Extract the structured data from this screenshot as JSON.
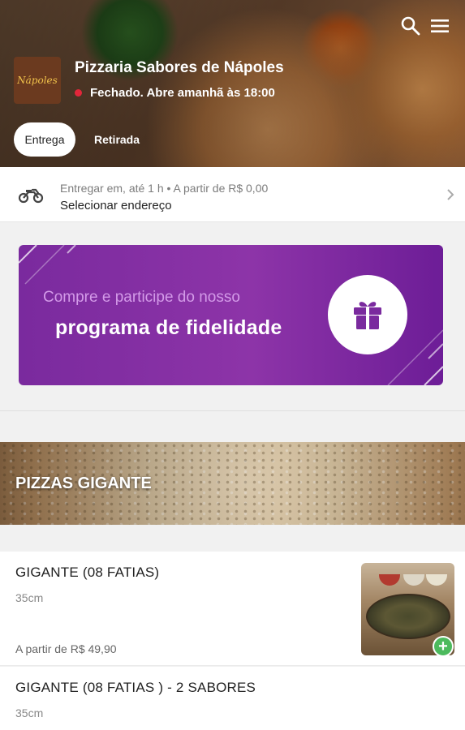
{
  "header": {
    "restaurant_name": "Pizzaria Sabores de Nápoles",
    "status_text": "Fechado. Abre amanhã às 18:00",
    "logo_text": "Nápoles",
    "tabs": [
      {
        "label": "Entrega",
        "selected": true
      },
      {
        "label": "Retirada",
        "selected": false
      }
    ],
    "icons": {
      "search": "search-icon",
      "menu": "menu-icon"
    },
    "status_color": "#e2263a"
  },
  "delivery": {
    "line1": "Entregar em, até 1 h  •  A partir de R$ 0,00",
    "line2": "Selecionar endereço",
    "icon": "motorcycle-icon"
  },
  "loyalty_banner": {
    "line1": "Compre e participe do nosso",
    "line2": "programa de fidelidade",
    "icon": "gift-icon",
    "color": "#7a2a9e"
  },
  "category": {
    "title": "PIZZAS GIGANTE"
  },
  "products": [
    {
      "name": "GIGANTE (08 FATIAS)",
      "size": "35cm",
      "price": "A partir de R$ 49,90",
      "add_label": "+"
    },
    {
      "name": "GIGANTE (08 FATIAS ) - 2 SABORES",
      "size": "35cm"
    }
  ],
  "colors": {
    "add_button": "#4cba5d"
  }
}
